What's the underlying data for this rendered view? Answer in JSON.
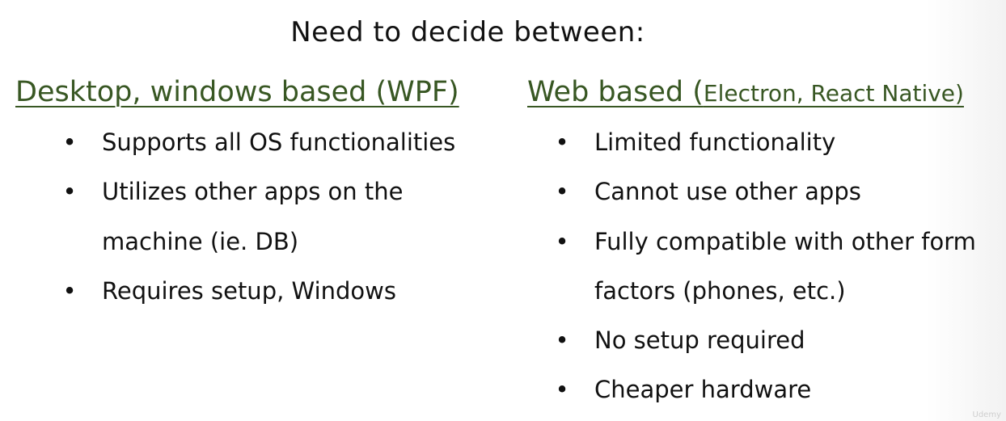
{
  "slide": {
    "title": "Need to decide between:",
    "left_column": {
      "heading": "Desktop, windows based (WPF)",
      "bullets": [
        {
          "lines": [
            "Supports all OS functionalities"
          ]
        },
        {
          "lines": [
            "Utilizes other apps on the",
            "machine (ie. DB)"
          ]
        },
        {
          "lines": [
            "Requires setup, Windows"
          ]
        }
      ]
    },
    "right_column": {
      "heading_main": "Web based (",
      "heading_small": "Electron, React Native)",
      "bullets": [
        {
          "lines": [
            "Limited functionality"
          ]
        },
        {
          "lines": [
            "Cannot use other apps"
          ]
        },
        {
          "lines": [
            "Fully compatible with other form",
            "factors (phones, etc.)"
          ]
        },
        {
          "lines": [
            "No setup required"
          ]
        },
        {
          "lines": [
            "Cheaper hardware"
          ]
        }
      ]
    },
    "bullet_glyph": "•",
    "watermark": "Udemy"
  },
  "colors": {
    "heading": "#385723",
    "text": "#111111",
    "background": "#ffffff"
  }
}
